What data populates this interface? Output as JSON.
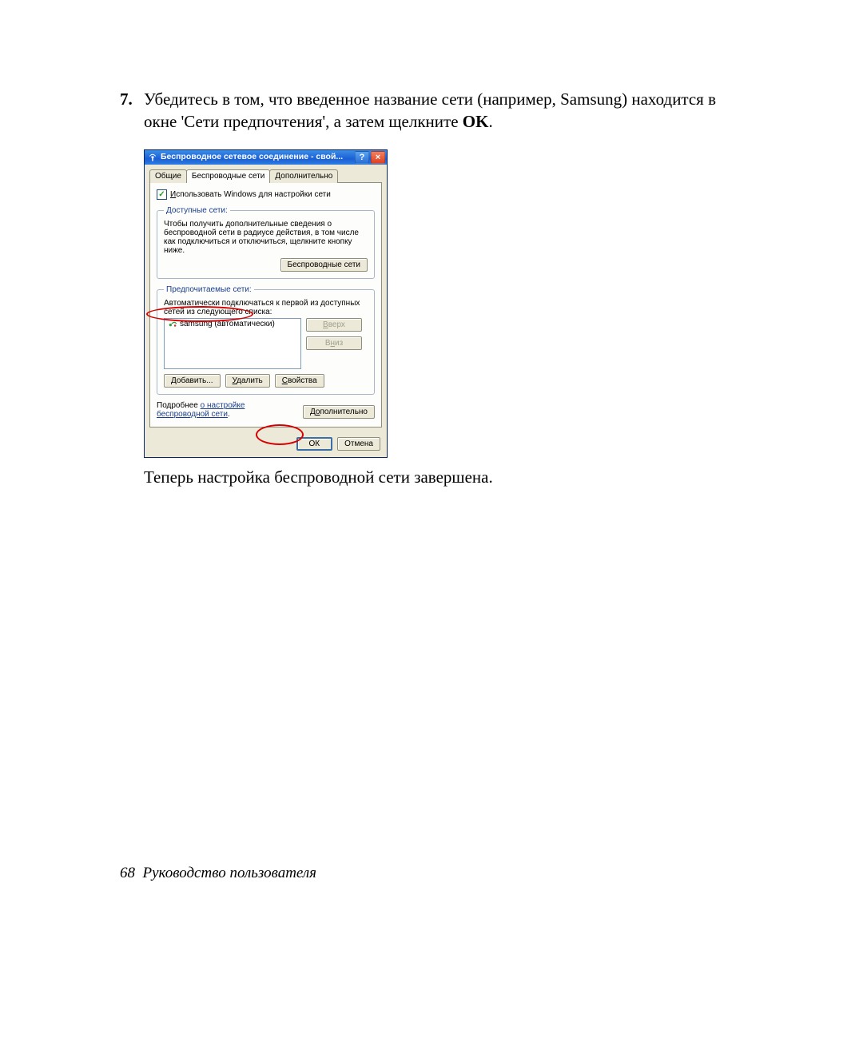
{
  "step": {
    "number": "7.",
    "text_a": "Убедитесь в том, что введенное название сети (например, Samsung) находится в окне 'Сети предпочтения', а затем щелкните ",
    "text_b": "OK",
    "text_c": "."
  },
  "dialog": {
    "title": "Беспроводное сетевое соединение - свой...",
    "help_btn": "?",
    "close_btn": "×",
    "tabs": {
      "general": "Общие",
      "wireless": "Беспроводные сети",
      "advanced": "Дополнительно"
    },
    "use_windows_label": "Использовать Windows для настройки сети",
    "use_windows_accel": "И",
    "available": {
      "legend": "Доступные сети:",
      "text": "Чтобы получить дополнительные сведения о беспроводной сети в радиусе действия, в том числе как подключиться и отключиться, щелкните кнопку ниже.",
      "button": "Беспроводные сети"
    },
    "preferred": {
      "legend": "Предпочитаемые сети:",
      "text": "Автоматически подключаться к первой из доступных сетей из следующего списка:",
      "list_item": "samsung (автоматически)",
      "up": "Вверх",
      "up_accel": "В",
      "down": "Вниз",
      "down_accel": "н",
      "add": "Добавить...",
      "add_accel": "Д",
      "remove": "Удалить",
      "remove_accel": "У",
      "props": "Свойства",
      "props_accel": "С"
    },
    "more_text_a": "Подробнее ",
    "more_link": "о настройке беспроводной сети",
    "more_text_b": ".",
    "advanced_btn": "Дополнительно",
    "advanced_btn_accel": "о",
    "ok": "ОК",
    "cancel": "Отмена"
  },
  "caption": "Теперь настройка беспроводной сети завершена.",
  "footer": {
    "page_num": "68",
    "title": "Руководство пользователя"
  }
}
